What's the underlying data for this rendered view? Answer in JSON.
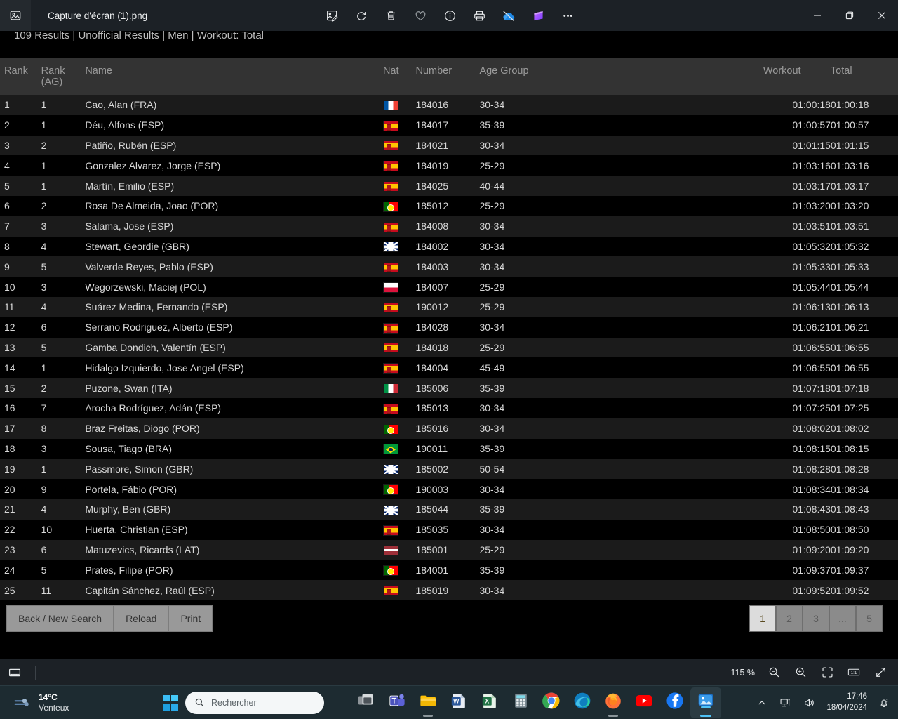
{
  "window": {
    "title": "Capture d'écran (1).png",
    "app_icon": "photo-icon",
    "toolbar": [
      {
        "name": "edit-image-icon",
        "label": "Modifier l'image"
      },
      {
        "name": "rotate-icon",
        "label": "Rotation"
      },
      {
        "name": "delete-icon",
        "label": "Supprimer"
      },
      {
        "name": "favorite-heart-icon",
        "label": "Favoris"
      },
      {
        "name": "info-icon",
        "label": "Informations"
      },
      {
        "name": "print-icon",
        "label": "Imprimer"
      },
      {
        "name": "onedrive-off-icon",
        "label": "OneDrive"
      },
      {
        "name": "clipchamp-icon",
        "label": "Clipchamp"
      },
      {
        "name": "more-options-icon",
        "label": "..."
      }
    ],
    "controls": {
      "minimize": "—",
      "restore": "❐",
      "close": "✕"
    }
  },
  "results_page": {
    "header": "109 Results | Unofficial Results | Men | Workout: Total",
    "columns": {
      "rank": "Rank",
      "rank_ag_line1": "Rank",
      "rank_ag_line2": "(AG)",
      "name": "Name",
      "nat": "Nat",
      "number": "Number",
      "age_group": "Age Group",
      "workout": "Workout",
      "total": "Total"
    },
    "rows": [
      {
        "rank": "1",
        "rank_ag": "1",
        "name": "Cao, Alan (FRA)",
        "flag": "f-fra",
        "number": "184016",
        "age_group": "30-34",
        "workout": "01:00:18",
        "total": "01:00:18"
      },
      {
        "rank": "2",
        "rank_ag": "1",
        "name": "Déu, Alfons (ESP)",
        "flag": "f-esp",
        "number": "184017",
        "age_group": "35-39",
        "workout": "01:00:57",
        "total": "01:00:57"
      },
      {
        "rank": "3",
        "rank_ag": "2",
        "name": "Patiño, Rubén (ESP)",
        "flag": "f-esp",
        "number": "184021",
        "age_group": "30-34",
        "workout": "01:01:15",
        "total": "01:01:15"
      },
      {
        "rank": "4",
        "rank_ag": "1",
        "name": "Gonzalez Alvarez, Jorge (ESP)",
        "flag": "f-esp",
        "number": "184019",
        "age_group": "25-29",
        "workout": "01:03:16",
        "total": "01:03:16"
      },
      {
        "rank": "5",
        "rank_ag": "1",
        "name": "Martín, Emilio (ESP)",
        "flag": "f-esp",
        "number": "184025",
        "age_group": "40-44",
        "workout": "01:03:17",
        "total": "01:03:17"
      },
      {
        "rank": "6",
        "rank_ag": "2",
        "name": "Rosa De Almeida, Joao (POR)",
        "flag": "f-por",
        "number": "185012",
        "age_group": "25-29",
        "workout": "01:03:20",
        "total": "01:03:20"
      },
      {
        "rank": "7",
        "rank_ag": "3",
        "name": "Salama, Jose (ESP)",
        "flag": "f-esp",
        "number": "184008",
        "age_group": "30-34",
        "workout": "01:03:51",
        "total": "01:03:51"
      },
      {
        "rank": "8",
        "rank_ag": "4",
        "name": "Stewart, Geordie (GBR)",
        "flag": "f-gbr",
        "number": "184002",
        "age_group": "30-34",
        "workout": "01:05:32",
        "total": "01:05:32"
      },
      {
        "rank": "9",
        "rank_ag": "5",
        "name": "Valverde Reyes, Pablo (ESP)",
        "flag": "f-esp",
        "number": "184003",
        "age_group": "30-34",
        "workout": "01:05:33",
        "total": "01:05:33"
      },
      {
        "rank": "10",
        "rank_ag": "3",
        "name": "Wegorzewski, Maciej (POL)",
        "flag": "f-pol",
        "number": "184007",
        "age_group": "25-29",
        "workout": "01:05:44",
        "total": "01:05:44"
      },
      {
        "rank": "11",
        "rank_ag": "4",
        "name": "Suárez Medina, Fernando (ESP)",
        "flag": "f-esp",
        "number": "190012",
        "age_group": "25-29",
        "workout": "01:06:13",
        "total": "01:06:13"
      },
      {
        "rank": "12",
        "rank_ag": "6",
        "name": "Serrano Rodriguez, Alberto (ESP)",
        "flag": "f-esp",
        "number": "184028",
        "age_group": "30-34",
        "workout": "01:06:21",
        "total": "01:06:21"
      },
      {
        "rank": "13",
        "rank_ag": "5",
        "name": "Gamba Dondich, Valentín (ESP)",
        "flag": "f-esp",
        "number": "184018",
        "age_group": "25-29",
        "workout": "01:06:55",
        "total": "01:06:55"
      },
      {
        "rank": "14",
        "rank_ag": "1",
        "name": "Hidalgo Izquierdo, Jose Angel (ESP)",
        "flag": "f-esp",
        "number": "184004",
        "age_group": "45-49",
        "workout": "01:06:55",
        "total": "01:06:55"
      },
      {
        "rank": "15",
        "rank_ag": "2",
        "name": "Puzone, Swan (ITA)",
        "flag": "f-ita",
        "number": "185006",
        "age_group": "35-39",
        "workout": "01:07:18",
        "total": "01:07:18"
      },
      {
        "rank": "16",
        "rank_ag": "7",
        "name": "Arocha Rodríguez, Adán (ESP)",
        "flag": "f-esp",
        "number": "185013",
        "age_group": "30-34",
        "workout": "01:07:25",
        "total": "01:07:25"
      },
      {
        "rank": "17",
        "rank_ag": "8",
        "name": "Braz Freitas, Diogo (POR)",
        "flag": "f-por",
        "number": "185016",
        "age_group": "30-34",
        "workout": "01:08:02",
        "total": "01:08:02"
      },
      {
        "rank": "18",
        "rank_ag": "3",
        "name": "Sousa, Tiago (BRA)",
        "flag": "f-bra",
        "number": "190011",
        "age_group": "35-39",
        "workout": "01:08:15",
        "total": "01:08:15"
      },
      {
        "rank": "19",
        "rank_ag": "1",
        "name": "Passmore, Simon (GBR)",
        "flag": "f-gbr",
        "number": "185002",
        "age_group": "50-54",
        "workout": "01:08:28",
        "total": "01:08:28"
      },
      {
        "rank": "20",
        "rank_ag": "9",
        "name": "Portela, Fábio (POR)",
        "flag": "f-por",
        "number": "190003",
        "age_group": "30-34",
        "workout": "01:08:34",
        "total": "01:08:34"
      },
      {
        "rank": "21",
        "rank_ag": "4",
        "name": "Murphy, Ben (GBR)",
        "flag": "f-gbr",
        "number": "185044",
        "age_group": "35-39",
        "workout": "01:08:43",
        "total": "01:08:43"
      },
      {
        "rank": "22",
        "rank_ag": "10",
        "name": "Huerta, Christian (ESP)",
        "flag": "f-esp",
        "number": "185035",
        "age_group": "30-34",
        "workout": "01:08:50",
        "total": "01:08:50"
      },
      {
        "rank": "23",
        "rank_ag": "6",
        "name": "Matuzevics, Ricards (LAT)",
        "flag": "f-lat",
        "number": "185001",
        "age_group": "25-29",
        "workout": "01:09:20",
        "total": "01:09:20"
      },
      {
        "rank": "24",
        "rank_ag": "5",
        "name": "Prates, Filipe (POR)",
        "flag": "f-por",
        "number": "184001",
        "age_group": "35-39",
        "workout": "01:09:37",
        "total": "01:09:37"
      },
      {
        "rank": "25",
        "rank_ag": "11",
        "name": "Capitán Sánchez, Raúl (ESP)",
        "flag": "f-esp",
        "number": "185019",
        "age_group": "30-34",
        "workout": "01:09:52",
        "total": "01:09:52"
      }
    ],
    "buttons": {
      "back": "Back / New Search",
      "reload": "Reload",
      "print": "Print"
    },
    "pagination": {
      "pages": [
        "1",
        "2",
        "3",
        "...",
        "5"
      ],
      "active": "1"
    }
  },
  "statusbar": {
    "gallery_icon": "filmstrip-icon",
    "zoom_level": "115 %",
    "zoom_out_icon": "zoom-out-icon",
    "zoom_in_icon": "zoom-in-icon",
    "fit_icon": "fit-to-window-icon",
    "actual_size_icon": "actual-size-icon",
    "fullscreen_icon": "fullscreen-icon"
  },
  "taskbar": {
    "weather": {
      "temp": "14°C",
      "desc": "Venteux"
    },
    "start_label": "Démarrer",
    "search": {
      "placeholder": "Rechercher"
    },
    "apps": [
      {
        "name": "task-view-icon",
        "label": "Affichage des tâches",
        "active": false,
        "indicator": false
      },
      {
        "name": "microsoft-teams-icon",
        "label": "Microsoft Teams",
        "active": false,
        "indicator": false
      },
      {
        "name": "file-explorer-icon",
        "label": "Explorateur de fichiers",
        "active": false,
        "indicator": true
      },
      {
        "name": "microsoft-word-icon",
        "label": "Word",
        "active": false,
        "indicator": false
      },
      {
        "name": "microsoft-excel-icon",
        "label": "Excel",
        "active": false,
        "indicator": false
      },
      {
        "name": "calculator-icon",
        "label": "Calculatrice",
        "active": false,
        "indicator": false
      },
      {
        "name": "google-chrome-icon",
        "label": "Google Chrome",
        "active": false,
        "indicator": false
      },
      {
        "name": "microsoft-edge-icon",
        "label": "Microsoft Edge",
        "active": false,
        "indicator": false
      },
      {
        "name": "firefox-icon",
        "label": "Firefox",
        "active": false,
        "indicator": true
      },
      {
        "name": "youtube-icon",
        "label": "YouTube",
        "active": false,
        "indicator": false
      },
      {
        "name": "facebook-icon",
        "label": "Facebook",
        "active": false,
        "indicator": false
      },
      {
        "name": "photos-icon",
        "label": "Photos",
        "active": true,
        "indicator": true
      }
    ],
    "tray": {
      "chevron_icon": "chevron-up-icon",
      "network_icon": "network-icon",
      "volume_icon": "volume-icon",
      "time": "17:46",
      "date": "18/04/2024",
      "notification_icon": "notification-bell-dnd-icon"
    }
  },
  "colors": {
    "name_yellow": "#ffe600",
    "header_bg": "#333333",
    "row_odd": "#1b1b1b",
    "row_even": "#000000",
    "app_chrome": "#1c2126",
    "taskbar": "#1d2b31",
    "accent": "#4fc3f7"
  }
}
